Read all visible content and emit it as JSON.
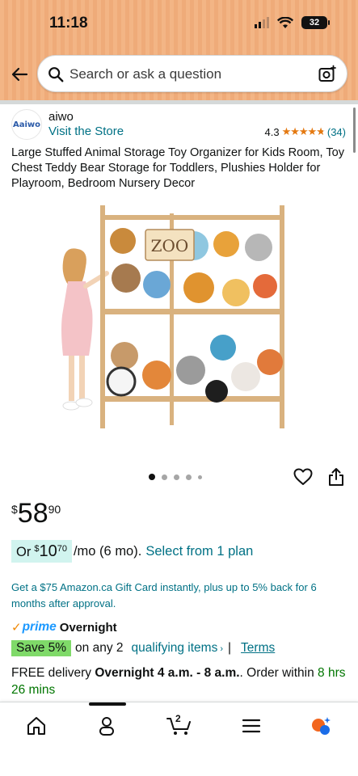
{
  "status_bar": {
    "time": "11:18",
    "battery": "32"
  },
  "search": {
    "placeholder": "Search or ask a question"
  },
  "icons": {
    "back": "back-arrow-icon",
    "search": "search-icon",
    "camera": "camera-search-icon",
    "heart": "heart-icon",
    "share": "share-icon",
    "home": "home-icon",
    "account": "account-icon",
    "cart": "cart-icon",
    "menu": "menu-icon",
    "rufus": "rufus-ai-icon"
  },
  "brand": {
    "logo_text": "Aaiwo",
    "name": "aiwo",
    "visit_store": "Visit the Store",
    "rating": "4.3",
    "rating_count": "(34)",
    "star_fraction": 0.86
  },
  "product": {
    "title": "Large Stuffed Animal Storage Toy Organizer for Kids Room, Toy Chest Teddy Bear Storage for Toddlers, Plushies Holder for Playroom, Bedroom Nursery Decor",
    "image_sign": "ZOO",
    "carousel_index": 1,
    "carousel_total": 5
  },
  "price": {
    "currency": "$",
    "whole": "58",
    "fraction": "90"
  },
  "plan": {
    "prefix": "Or",
    "currency": "$",
    "whole": "10",
    "fraction": "70",
    "suffix": "/mo (6 mo).",
    "link": "Select from 1 plan"
  },
  "gift_card": "Get a $75 Amazon.ca Gift Card instantly, plus up to 5% back for 6 months after approval.",
  "prime": {
    "check": "✓",
    "brand": "prime",
    "label": "Overnight"
  },
  "save": {
    "badge": "Save 5%",
    "text": "on any 2",
    "link": "qualifying items",
    "chevron": "›",
    "separator": "|",
    "terms": "Terms"
  },
  "delivery": {
    "prefix": "FREE delivery",
    "window": "Overnight 4 a.m. - 8 a.m.",
    "suffix": ". Order within",
    "countdown": "8 hrs 26 mins"
  },
  "nav": {
    "cart_count": "2"
  },
  "colors": {
    "header": "#f3b585",
    "link": "#007185",
    "star": "#e47911",
    "prime": "#1a98ff",
    "save_badge": "#7fda69",
    "plan_pill": "#d1f4ef",
    "countdown": "#007600"
  }
}
